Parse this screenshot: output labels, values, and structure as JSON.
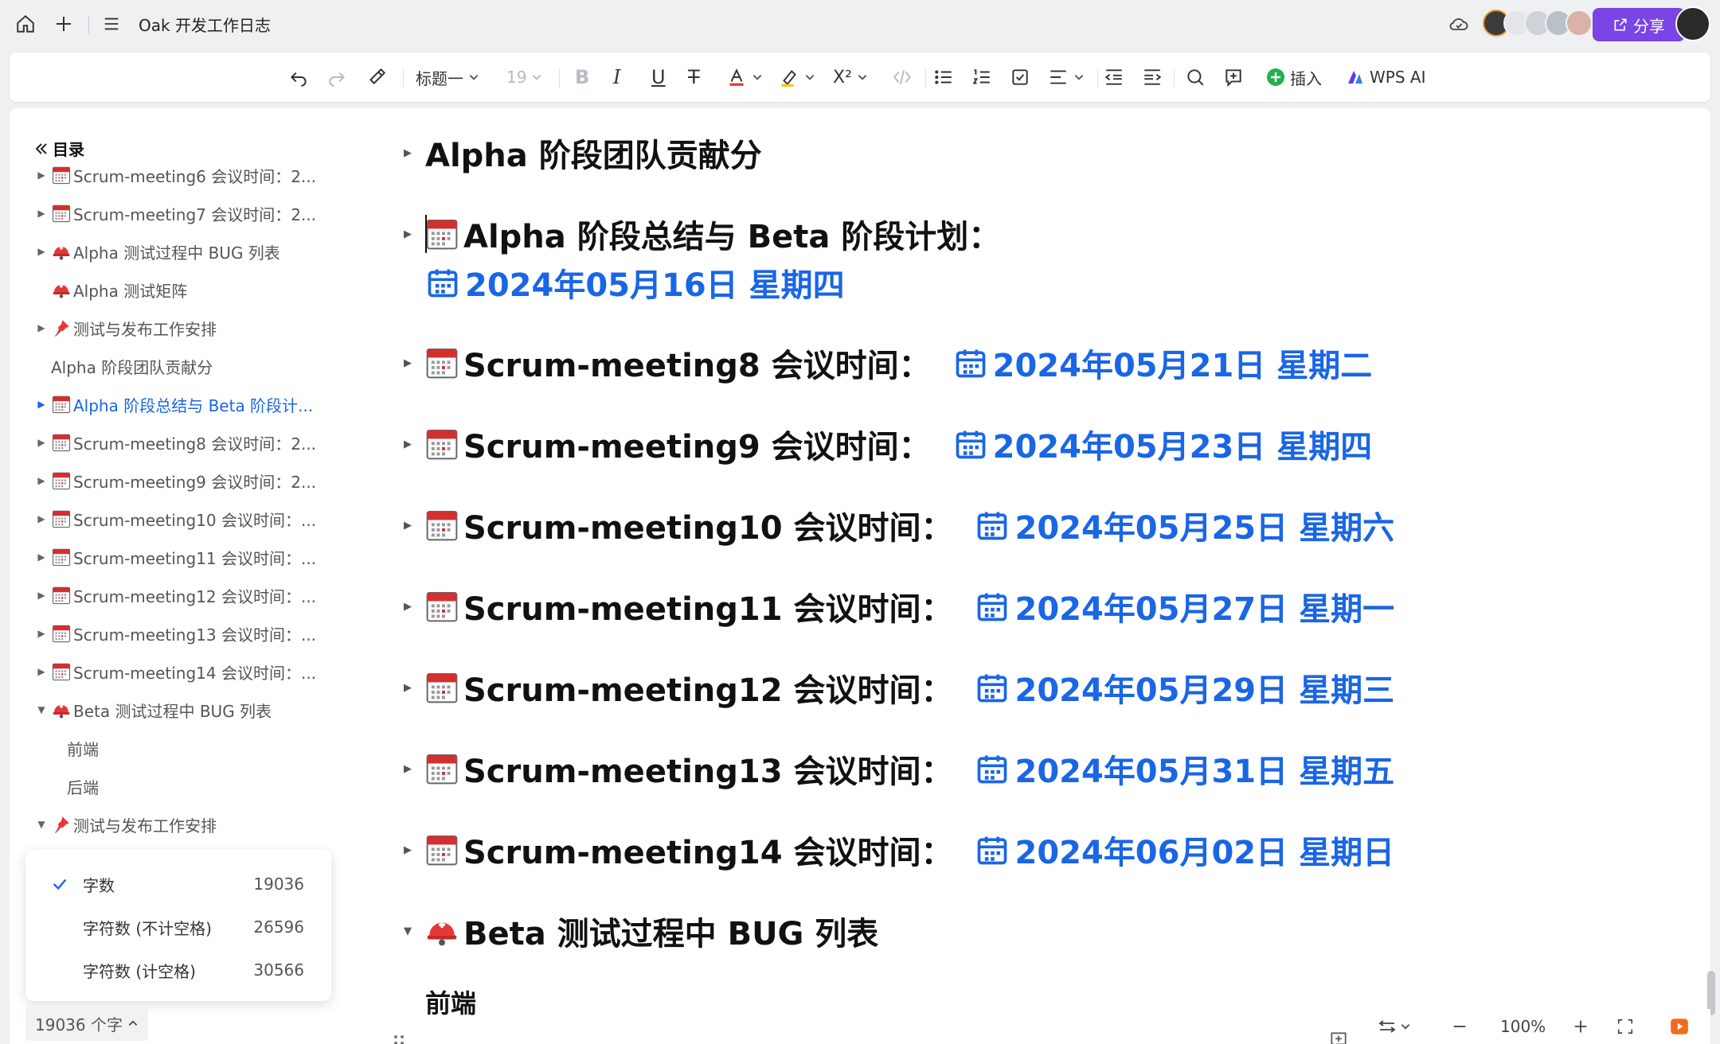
{
  "window": {
    "doc_title": "Oak 开发工作日志",
    "share_label": "分享"
  },
  "toolbar": {
    "heading_style": "标题一",
    "font_size": "19",
    "insert_label": "插入",
    "ai_label": "WPS AI"
  },
  "toc": {
    "title": "目录",
    "items": [
      {
        "label": "Scrum-meeting6 会议时间：2...",
        "icon": "calendar-icon",
        "arrow": "right"
      },
      {
        "label": "Scrum-meeting7 会议时间：2...",
        "icon": "calendar-icon",
        "arrow": "right"
      },
      {
        "label": "Alpha 测试过程中 BUG 列表",
        "icon": "helmet-icon",
        "arrow": "right"
      },
      {
        "label": "Alpha 测试矩阵",
        "icon": "helmet-icon",
        "arrow": "none"
      },
      {
        "label": "测试与发布工作安排",
        "icon": "pushpin-icon",
        "arrow": "right"
      },
      {
        "label": "Alpha 阶段团队贡献分",
        "icon": "",
        "arrow": "none"
      },
      {
        "label": "Alpha 阶段总结与 Beta 阶段计...",
        "icon": "calendar-icon",
        "arrow": "right",
        "active": true
      },
      {
        "label": "Scrum-meeting8 会议时间：2...",
        "icon": "calendar-icon",
        "arrow": "right"
      },
      {
        "label": "Scrum-meeting9 会议时间：2...",
        "icon": "calendar-icon",
        "arrow": "right"
      },
      {
        "label": "Scrum-meeting10 会议时间：...",
        "icon": "calendar-icon",
        "arrow": "right"
      },
      {
        "label": "Scrum-meeting11 会议时间：...",
        "icon": "calendar-icon",
        "arrow": "right"
      },
      {
        "label": "Scrum-meeting12 会议时间：...",
        "icon": "calendar-icon",
        "arrow": "right"
      },
      {
        "label": "Scrum-meeting13 会议时间：...",
        "icon": "calendar-icon",
        "arrow": "right"
      },
      {
        "label": "Scrum-meeting14 会议时间：...",
        "icon": "calendar-icon",
        "arrow": "right"
      },
      {
        "label": "Beta 测试过程中 BUG 列表",
        "icon": "helmet-icon",
        "arrow": "down"
      },
      {
        "label": "前端",
        "icon": "",
        "arrow": "none",
        "sub": true
      },
      {
        "label": "后端",
        "icon": "",
        "arrow": "none",
        "sub": true
      },
      {
        "label": "测试与发布工作安排",
        "icon": "pushpin-icon",
        "arrow": "down"
      }
    ]
  },
  "word_count": {
    "rows": [
      {
        "label": "字数",
        "value": "19036",
        "checked": true
      },
      {
        "label": "字符数 (不计空格)",
        "value": "26596",
        "checked": false
      },
      {
        "label": "字符数 (计空格)",
        "value": "30566",
        "checked": false
      }
    ],
    "status_label": "19036 个字"
  },
  "content": {
    "headings": [
      {
        "text": "Alpha 阶段团队贡献分",
        "icon": "",
        "date": ""
      },
      {
        "text": "Alpha 阶段总结与 Beta 阶段计划：",
        "icon": "calendar-icon",
        "date": "2024年05月16日 星期四",
        "date_newline": true
      },
      {
        "text": "Scrum-meeting8 会议时间：",
        "icon": "calendar-icon",
        "date": "2024年05月21日 星期二"
      },
      {
        "text": "Scrum-meeting9 会议时间：",
        "icon": "calendar-icon",
        "date": "2024年05月23日 星期四"
      },
      {
        "text": "Scrum-meeting10 会议时间：",
        "icon": "calendar-icon",
        "date": "2024年05月25日 星期六"
      },
      {
        "text": "Scrum-meeting11 会议时间：",
        "icon": "calendar-icon",
        "date": "2024年05月27日 星期一"
      },
      {
        "text": "Scrum-meeting12 会议时间：",
        "icon": "calendar-icon",
        "date": "2024年05月29日 星期三"
      },
      {
        "text": "Scrum-meeting13 会议时间：",
        "icon": "calendar-icon",
        "date": "2024年05月31日 星期五"
      },
      {
        "text": "Scrum-meeting14 会议时间：",
        "icon": "calendar-icon",
        "date": "2024年06月02日 星期日"
      },
      {
        "text": "Beta 测试过程中 BUG 列表",
        "icon": "helmet-icon",
        "date": "",
        "expanded": true
      }
    ],
    "subheading": "前端"
  },
  "status_bar": {
    "zoom": "100%"
  },
  "colors": {
    "accent": "#1a66e5",
    "share": "#7a44e6"
  }
}
